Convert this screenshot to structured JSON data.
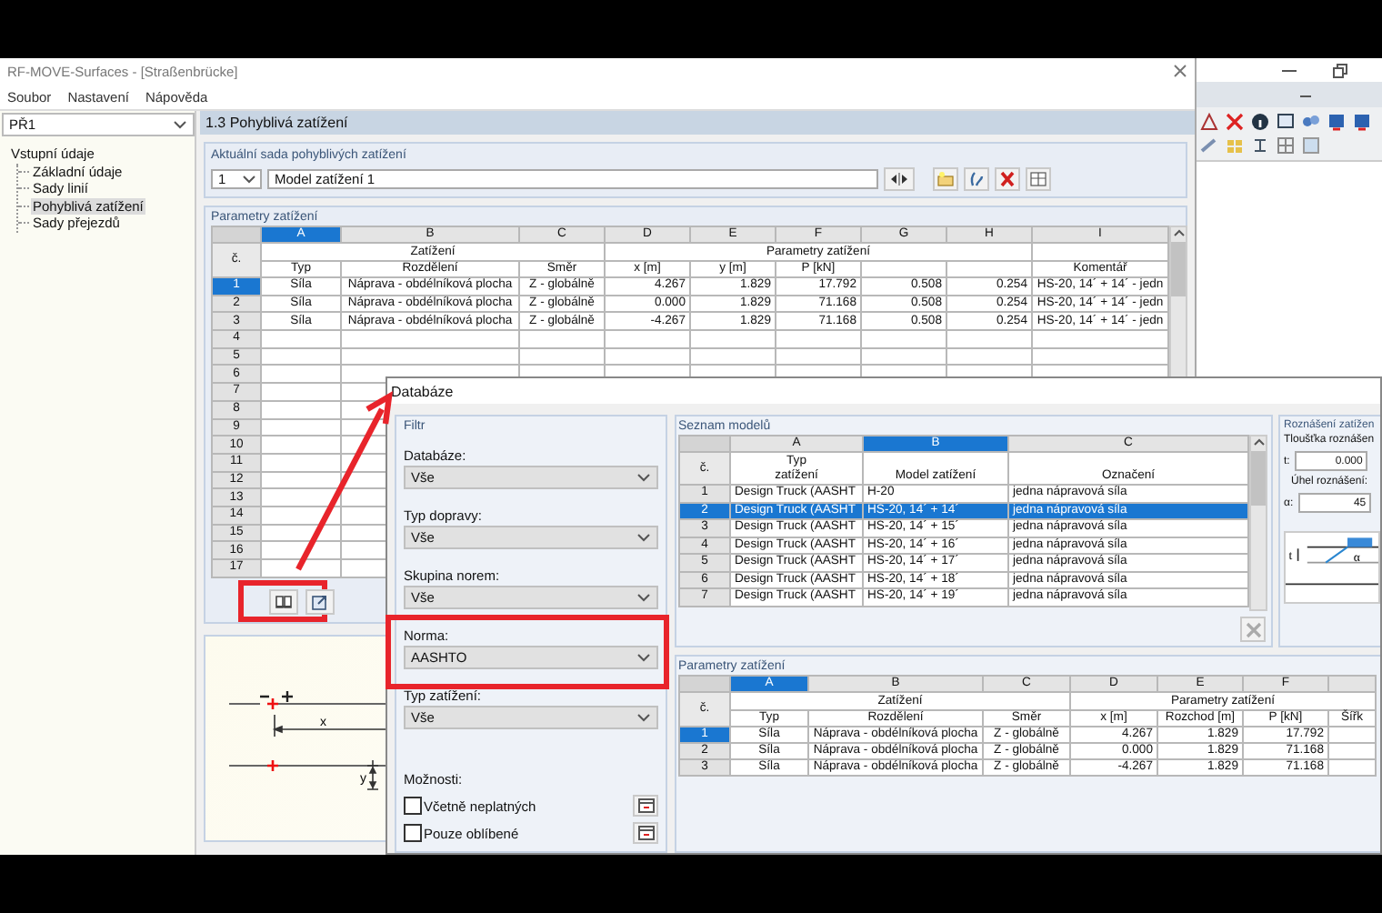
{
  "main_window": {
    "title": "RF-MOVE-Surfaces - [Straßenbrücke]",
    "menu": [
      "Soubor",
      "Nastavení",
      "Nápověda"
    ],
    "case_select": "PŘ1",
    "tree": {
      "label": "Vstupní údaje",
      "expanded": true,
      "children": [
        {
          "label": "Základní údaje",
          "selected": false
        },
        {
          "label": "Sady linií",
          "selected": false
        },
        {
          "label": "Pohyblivá zatížení",
          "selected": true
        },
        {
          "label": "Sady přejezdů",
          "selected": false
        }
      ]
    },
    "section_title": "1.3 Pohyblivá zatížení",
    "current_set": {
      "title": "Aktuální sada pohyblivých zatížení",
      "number": "1",
      "name": "Model zatížení 1"
    },
    "load_table": {
      "title": "Parametry zatížení",
      "number_heading": "č.",
      "kind": "grid",
      "column_groups": [
        {
          "label": "Zatížení",
          "columns": [
            {
              "letter": "A",
              "heading": "Typ",
              "selected": true,
              "kind": "text"
            },
            {
              "letter": "B",
              "heading": "Rozdělení",
              "selected": false,
              "kind": "text"
            },
            {
              "letter": "C",
              "heading": "Směr",
              "selected": false,
              "kind": "text"
            }
          ]
        },
        {
          "label": "Parametry zatížení",
          "columns": [
            {
              "letter": "D",
              "heading": "x [m]",
              "selected": false,
              "kind": "number"
            },
            {
              "letter": "E",
              "heading": "y [m]",
              "selected": false,
              "kind": "number"
            },
            {
              "letter": "F",
              "heading": "P [kN]",
              "selected": false,
              "kind": "number"
            },
            {
              "letter": "G",
              "selected": false,
              "kind": "number"
            },
            {
              "letter": "H",
              "selected": false,
              "kind": "number"
            }
          ]
        },
        {
          "columns": [
            {
              "letter": "I",
              "heading": "Komentář",
              "selected": false,
              "kind": "text"
            }
          ]
        }
      ],
      "rows": [
        {
          "number": "1",
          "selected": true,
          "cells": [
            "Síla",
            "Náprava - obdélníková plocha",
            "Z - globálně",
            "4.267",
            "1.829",
            "17.792",
            "0.508",
            "0.254",
            "HS-20, 14´ + 14´ - jedn"
          ]
        },
        {
          "number": "2",
          "selected": false,
          "cells": [
            "Síla",
            "Náprava - obdélníková plocha",
            "Z - globálně",
            "0.000",
            "1.829",
            "71.168",
            "0.508",
            "0.254",
            "HS-20, 14´ + 14´ - jedn"
          ]
        },
        {
          "number": "3",
          "selected": false,
          "cells": [
            "Síla",
            "Náprava - obdélníková plocha",
            "Z - globálně",
            "-4.267",
            "1.829",
            "71.168",
            "0.508",
            "0.254",
            "HS-20, 14´ + 14´ - jedn"
          ]
        },
        {
          "number": "4",
          "selected": false
        },
        {
          "number": "5",
          "selected": false
        },
        {
          "number": "6",
          "selected": false
        },
        {
          "number": "7",
          "selected": false
        },
        {
          "number": "8",
          "selected": false
        },
        {
          "number": "9",
          "selected": false
        },
        {
          "number": "10",
          "selected": false
        },
        {
          "number": "11",
          "selected": false
        },
        {
          "number": "12",
          "selected": false
        },
        {
          "number": "13",
          "selected": false
        },
        {
          "number": "14",
          "selected": false
        },
        {
          "number": "15",
          "selected": false
        },
        {
          "number": "16",
          "selected": false
        },
        {
          "number": "17",
          "selected": false
        }
      ]
    },
    "table_toolbar": [
      {
        "kind": "database",
        "highlighted": true
      },
      {
        "kind": "export",
        "highlighted": false
      }
    ],
    "diagram": {
      "labels": [
        "x",
        "y"
      ]
    }
  },
  "dialog": {
    "title": "Databáze",
    "filter": {
      "title": "Filtr",
      "fields": [
        {
          "label": "Databáze:",
          "value": "Vše",
          "highlighted": false
        },
        {
          "label": "Typ dopravy:",
          "value": "Vše",
          "highlighted": false
        },
        {
          "label": "Skupina norem:",
          "value": "Vše",
          "highlighted": false
        },
        {
          "label": "Norma:",
          "value": "AASHTO",
          "highlighted": true
        },
        {
          "label": "Typ zatížení:",
          "value": "Vše",
          "highlighted": false
        }
      ],
      "options_title": "Možnosti:",
      "options": [
        {
          "label": "Včetně neplatných",
          "checked": false
        },
        {
          "label": "Pouze oblíbené",
          "checked": false
        }
      ]
    },
    "model_list": {
      "title": "Seznam modelů",
      "number_heading": "č.",
      "kind": "list",
      "columns": [
        {
          "letter": "A",
          "heading": "Typ\nzatížení",
          "selected": false,
          "kind": "text"
        },
        {
          "letter": "B",
          "heading": "Model zatížení",
          "selected": true,
          "kind": "text"
        },
        {
          "letter": "C",
          "heading": "Označení",
          "selected": false,
          "kind": "text"
        }
      ],
      "rows": [
        {
          "number": "1",
          "selected": false,
          "cells": [
            "Design Truck (AASHT",
            "H-20",
            "jedna nápravová síla"
          ]
        },
        {
          "number": "2",
          "selected": true,
          "cells": [
            "Design Truck (AASHT",
            "HS-20, 14´ + 14´",
            "jedna nápravová síla"
          ]
        },
        {
          "number": "3",
          "selected": false,
          "cells": [
            "Design Truck (AASHT",
            "HS-20, 14´ + 15´",
            "jedna nápravová síla"
          ]
        },
        {
          "number": "4",
          "selected": false,
          "cells": [
            "Design Truck (AASHT",
            "HS-20, 14´ + 16´",
            "jedna nápravová síla"
          ]
        },
        {
          "number": "5",
          "selected": false,
          "cells": [
            "Design Truck (AASHT",
            "HS-20, 14´ + 17´",
            "jedna nápravová síla"
          ]
        },
        {
          "number": "6",
          "selected": false,
          "cells": [
            "Design Truck (AASHT",
            "HS-20, 14´ + 18´",
            "jedna nápravová síla"
          ]
        },
        {
          "number": "7",
          "selected": false,
          "cells": [
            "Design Truck (AASHT",
            "HS-20, 14´ + 19´",
            "jedna nápravová síla"
          ]
        }
      ]
    },
    "spread": {
      "title": "Roznášení zatížen",
      "thickness_label": "Tloušťka roznášen",
      "t_label": "t:",
      "t_value": "0.000",
      "angle_label": "Úhel roznášení:",
      "alpha_label": "α:",
      "alpha_value": "45",
      "drawing_labels": [
        "t",
        "α"
      ]
    },
    "load_table": {
      "title": "Parametry zatížení",
      "number_heading": "č.",
      "kind": "grid",
      "column_groups": [
        {
          "label": "Zatížení",
          "columns": [
            {
              "letter": "A",
              "heading": "Typ",
              "selected": true,
              "kind": "text"
            },
            {
              "letter": "B",
              "heading": "Rozdělení",
              "selected": false,
              "kind": "text"
            },
            {
              "letter": "C",
              "heading": "Směr",
              "selected": false,
              "kind": "text"
            }
          ]
        },
        {
          "label": "Parametry zatížení",
          "columns": [
            {
              "letter": "D",
              "heading": "x [m]",
              "selected": false,
              "kind": "number"
            },
            {
              "letter": "E",
              "heading": "Rozchod [m]",
              "selected": false,
              "kind": "number"
            },
            {
              "letter": "F",
              "heading": "P [kN]",
              "selected": false,
              "kind": "number"
            },
            {
              "heading": "Šířk",
              "selected": false,
              "kind": "text"
            }
          ]
        }
      ],
      "rows": [
        {
          "number": "1",
          "selected": true,
          "cells": [
            "Síla",
            "Náprava - obdélníková plocha",
            "Z - globálně",
            "4.267",
            "1.829",
            "17.792"
          ]
        },
        {
          "number": "2",
          "selected": false,
          "cells": [
            "Síla",
            "Náprava - obdélníková plocha",
            "Z - globálně",
            "0.000",
            "1.829",
            "71.168"
          ]
        },
        {
          "number": "3",
          "selected": false,
          "cells": [
            "Síla",
            "Náprava - obdélníková plocha",
            "Z - globálně",
            "-4.267",
            "1.829",
            "71.168"
          ]
        }
      ]
    }
  }
}
